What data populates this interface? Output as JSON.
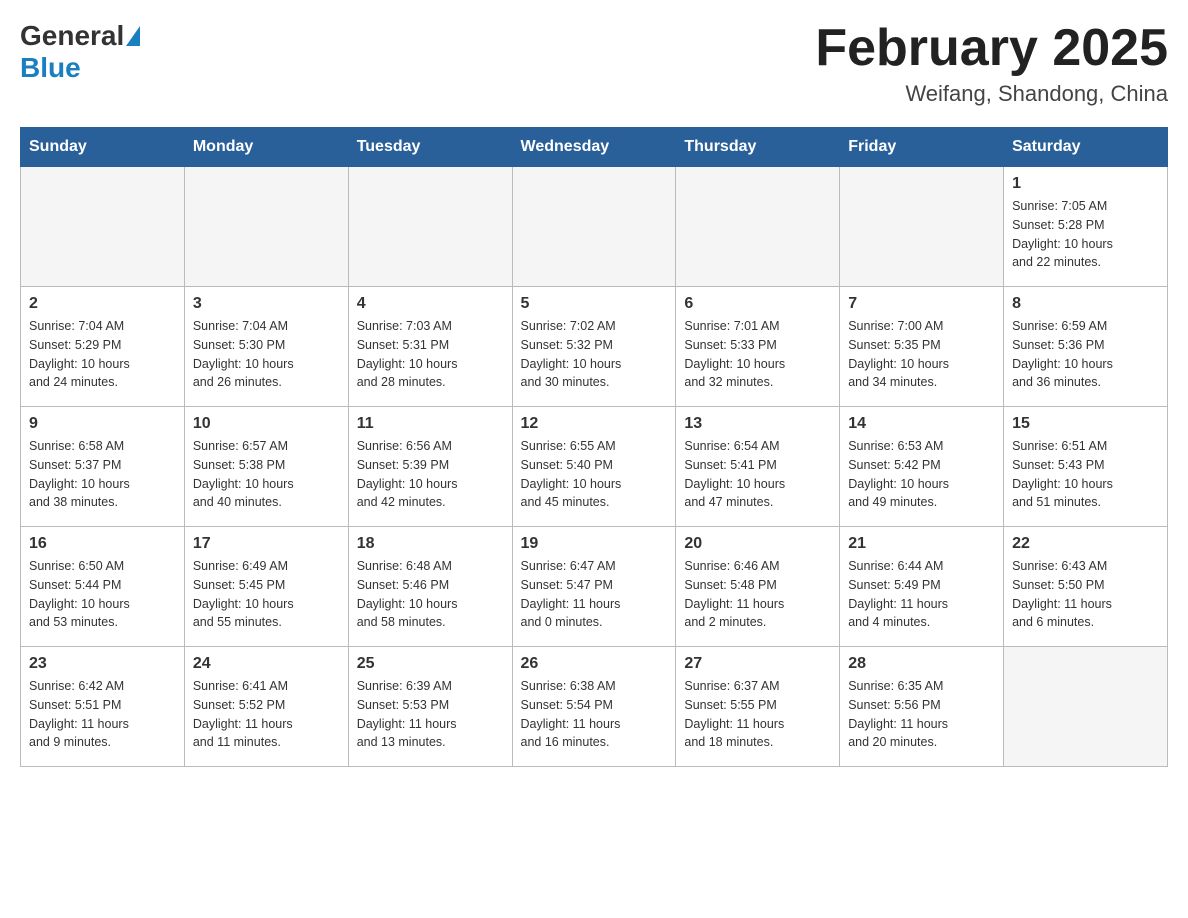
{
  "header": {
    "logo_general": "General",
    "logo_blue": "Blue",
    "month_title": "February 2025",
    "location": "Weifang, Shandong, China"
  },
  "weekdays": [
    "Sunday",
    "Monday",
    "Tuesday",
    "Wednesday",
    "Thursday",
    "Friday",
    "Saturday"
  ],
  "weeks": [
    [
      {
        "day": "",
        "info": ""
      },
      {
        "day": "",
        "info": ""
      },
      {
        "day": "",
        "info": ""
      },
      {
        "day": "",
        "info": ""
      },
      {
        "day": "",
        "info": ""
      },
      {
        "day": "",
        "info": ""
      },
      {
        "day": "1",
        "info": "Sunrise: 7:05 AM\nSunset: 5:28 PM\nDaylight: 10 hours\nand 22 minutes."
      }
    ],
    [
      {
        "day": "2",
        "info": "Sunrise: 7:04 AM\nSunset: 5:29 PM\nDaylight: 10 hours\nand 24 minutes."
      },
      {
        "day": "3",
        "info": "Sunrise: 7:04 AM\nSunset: 5:30 PM\nDaylight: 10 hours\nand 26 minutes."
      },
      {
        "day": "4",
        "info": "Sunrise: 7:03 AM\nSunset: 5:31 PM\nDaylight: 10 hours\nand 28 minutes."
      },
      {
        "day": "5",
        "info": "Sunrise: 7:02 AM\nSunset: 5:32 PM\nDaylight: 10 hours\nand 30 minutes."
      },
      {
        "day": "6",
        "info": "Sunrise: 7:01 AM\nSunset: 5:33 PM\nDaylight: 10 hours\nand 32 minutes."
      },
      {
        "day": "7",
        "info": "Sunrise: 7:00 AM\nSunset: 5:35 PM\nDaylight: 10 hours\nand 34 minutes."
      },
      {
        "day": "8",
        "info": "Sunrise: 6:59 AM\nSunset: 5:36 PM\nDaylight: 10 hours\nand 36 minutes."
      }
    ],
    [
      {
        "day": "9",
        "info": "Sunrise: 6:58 AM\nSunset: 5:37 PM\nDaylight: 10 hours\nand 38 minutes."
      },
      {
        "day": "10",
        "info": "Sunrise: 6:57 AM\nSunset: 5:38 PM\nDaylight: 10 hours\nand 40 minutes."
      },
      {
        "day": "11",
        "info": "Sunrise: 6:56 AM\nSunset: 5:39 PM\nDaylight: 10 hours\nand 42 minutes."
      },
      {
        "day": "12",
        "info": "Sunrise: 6:55 AM\nSunset: 5:40 PM\nDaylight: 10 hours\nand 45 minutes."
      },
      {
        "day": "13",
        "info": "Sunrise: 6:54 AM\nSunset: 5:41 PM\nDaylight: 10 hours\nand 47 minutes."
      },
      {
        "day": "14",
        "info": "Sunrise: 6:53 AM\nSunset: 5:42 PM\nDaylight: 10 hours\nand 49 minutes."
      },
      {
        "day": "15",
        "info": "Sunrise: 6:51 AM\nSunset: 5:43 PM\nDaylight: 10 hours\nand 51 minutes."
      }
    ],
    [
      {
        "day": "16",
        "info": "Sunrise: 6:50 AM\nSunset: 5:44 PM\nDaylight: 10 hours\nand 53 minutes."
      },
      {
        "day": "17",
        "info": "Sunrise: 6:49 AM\nSunset: 5:45 PM\nDaylight: 10 hours\nand 55 minutes."
      },
      {
        "day": "18",
        "info": "Sunrise: 6:48 AM\nSunset: 5:46 PM\nDaylight: 10 hours\nand 58 minutes."
      },
      {
        "day": "19",
        "info": "Sunrise: 6:47 AM\nSunset: 5:47 PM\nDaylight: 11 hours\nand 0 minutes."
      },
      {
        "day": "20",
        "info": "Sunrise: 6:46 AM\nSunset: 5:48 PM\nDaylight: 11 hours\nand 2 minutes."
      },
      {
        "day": "21",
        "info": "Sunrise: 6:44 AM\nSunset: 5:49 PM\nDaylight: 11 hours\nand 4 minutes."
      },
      {
        "day": "22",
        "info": "Sunrise: 6:43 AM\nSunset: 5:50 PM\nDaylight: 11 hours\nand 6 minutes."
      }
    ],
    [
      {
        "day": "23",
        "info": "Sunrise: 6:42 AM\nSunset: 5:51 PM\nDaylight: 11 hours\nand 9 minutes."
      },
      {
        "day": "24",
        "info": "Sunrise: 6:41 AM\nSunset: 5:52 PM\nDaylight: 11 hours\nand 11 minutes."
      },
      {
        "day": "25",
        "info": "Sunrise: 6:39 AM\nSunset: 5:53 PM\nDaylight: 11 hours\nand 13 minutes."
      },
      {
        "day": "26",
        "info": "Sunrise: 6:38 AM\nSunset: 5:54 PM\nDaylight: 11 hours\nand 16 minutes."
      },
      {
        "day": "27",
        "info": "Sunrise: 6:37 AM\nSunset: 5:55 PM\nDaylight: 11 hours\nand 18 minutes."
      },
      {
        "day": "28",
        "info": "Sunrise: 6:35 AM\nSunset: 5:56 PM\nDaylight: 11 hours\nand 20 minutes."
      },
      {
        "day": "",
        "info": ""
      }
    ]
  ]
}
